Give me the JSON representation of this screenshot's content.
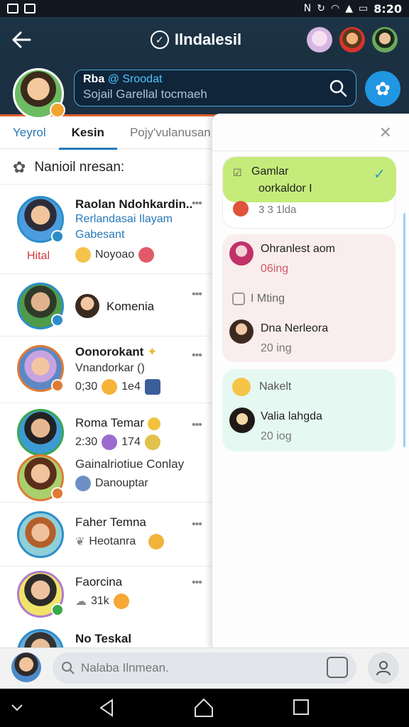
{
  "status_bar": {
    "time": "8:20",
    "icons": [
      "notification-icon",
      "image-icon",
      "nfc-icon",
      "sync-icon",
      "wifi-icon",
      "signal-icon",
      "battery-icon"
    ]
  },
  "app_bar": {
    "title": "Ilndalesil",
    "back_icon": "arrow-left-icon",
    "title_icon": "globe-icon"
  },
  "profile": {
    "search_name": "Rba",
    "search_name_highlight": "@ Sroodat",
    "search_sub": "Sojail Garellal tocmaeh"
  },
  "tabs": [
    "Yeyrol",
    "Kesin",
    "Pojy'vulanusan"
  ],
  "section_title": "Nanioil nresan:",
  "chats": [
    {
      "name": "Raolan Ndohkardin..",
      "line1": "Rerlandasai Ilayam",
      "line2": "Gabesant",
      "tag": "Hital",
      "line3": "Noyoao"
    },
    {
      "name": "Komenia"
    },
    {
      "name": "Oonorokant",
      "line1": "Vnandorkar ()",
      "line2": "0;30",
      "line2b": "1e4"
    },
    {
      "name": "Roma Temar",
      "line1": "2:30",
      "line1b": "174"
    },
    {
      "name": "Gainalriotiue Conlay",
      "line1": "Danouptar"
    },
    {
      "name": "Faher Temna",
      "line1": "Heotanra"
    },
    {
      "name": "Faorcina",
      "line1": "31k"
    },
    {
      "name": "No Teskal"
    }
  ],
  "panel": {
    "cards": [
      {
        "title": "Gamlar",
        "subtitle": "oorkaldor I",
        "meta": "3 3 1lda"
      },
      {
        "title": "Ohranlest aom",
        "subtitle": "06ing",
        "section": "I Mting",
        "person": "Dna Nerleora",
        "person_meta": "20 ing"
      },
      {
        "title": "Nakelt",
        "person": "Valia lahgda",
        "person_meta": "20 iog"
      }
    ]
  },
  "bottom": {
    "placeholder": "Nalaba Ilnmean."
  },
  "colors": {
    "app_bar": "#1d3447",
    "accent_blue": "#2779b8",
    "fab": "#2196e3",
    "card_green": "#c5ec7a",
    "card_pink": "#f9eded",
    "card_mint": "#e6f8f2",
    "tag_red": "#d13b3b"
  }
}
